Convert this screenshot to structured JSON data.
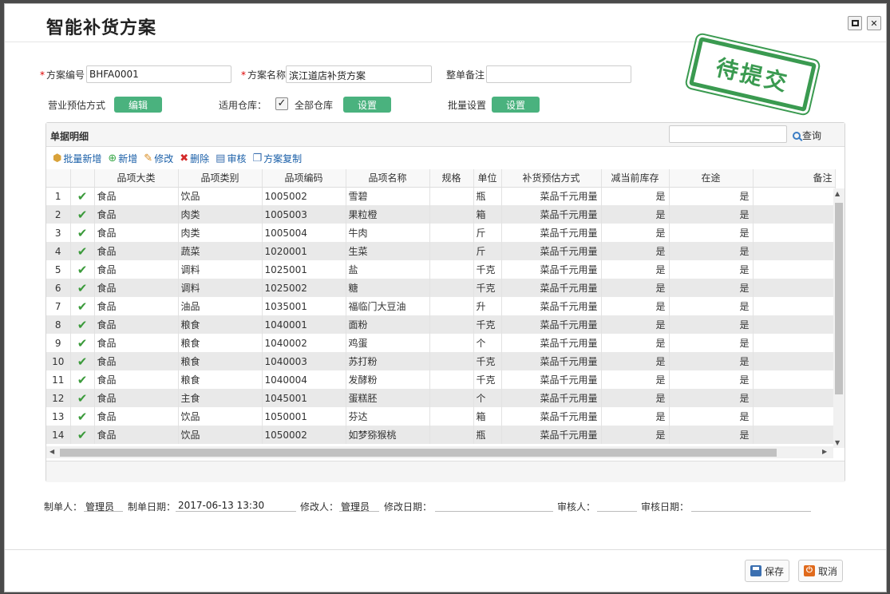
{
  "window": {
    "title": "智能补货方案",
    "stamp": "待提交"
  },
  "form": {
    "plan_no_label": "方案编号",
    "plan_no_value": "BHFA0001",
    "plan_name_label": "方案名称",
    "plan_name_value": "滨江道店补货方案",
    "remark_label": "整单备注",
    "remark_value": "",
    "forecast_label": "营业预估方式",
    "forecast_button": "编辑",
    "warehouse_label": "适用仓库：",
    "warehouse_checked": true,
    "warehouse_value": "全部仓库",
    "warehouse_button": "设置",
    "batch_label": "批量设置",
    "batch_button": "设置",
    "required_mark": "*"
  },
  "detail": {
    "title": "单据明细",
    "search_placeholder": "",
    "search_button": "查询",
    "toolbar": {
      "batch_add": "批量新增",
      "add": "新增",
      "edit": "修改",
      "delete": "删除",
      "audit": "审核",
      "copy": "方案复制"
    },
    "columns": [
      "",
      "",
      "品项大类",
      "品项类别",
      "品项编码",
      "品项名称",
      "规格",
      "单位",
      "补货预估方式",
      "减当前库存",
      "在途",
      "备注"
    ],
    "rows": [
      {
        "no": "1",
        "category": "食品",
        "type": "饮品",
        "code": "1005002",
        "name": "雪碧",
        "spec": "",
        "unit": "瓶",
        "method": "菜品千元用量",
        "reduce": "是",
        "transit": "是",
        "note": ""
      },
      {
        "no": "2",
        "category": "食品",
        "type": "肉类",
        "code": "1005003",
        "name": "果粒橙",
        "spec": "",
        "unit": "箱",
        "method": "菜品千元用量",
        "reduce": "是",
        "transit": "是",
        "note": ""
      },
      {
        "no": "3",
        "category": "食品",
        "type": "肉类",
        "code": "1005004",
        "name": "牛肉",
        "spec": "",
        "unit": "斤",
        "method": "菜品千元用量",
        "reduce": "是",
        "transit": "是",
        "note": ""
      },
      {
        "no": "4",
        "category": "食品",
        "type": "蔬菜",
        "code": "1020001",
        "name": "生菜",
        "spec": "",
        "unit": "斤",
        "method": "菜品千元用量",
        "reduce": "是",
        "transit": "是",
        "note": ""
      },
      {
        "no": "5",
        "category": "食品",
        "type": "调料",
        "code": "1025001",
        "name": "盐",
        "spec": "",
        "unit": "千克",
        "method": "菜品千元用量",
        "reduce": "是",
        "transit": "是",
        "note": ""
      },
      {
        "no": "6",
        "category": "食品",
        "type": "调料",
        "code": "1025002",
        "name": "糖",
        "spec": "",
        "unit": "千克",
        "method": "菜品千元用量",
        "reduce": "是",
        "transit": "是",
        "note": ""
      },
      {
        "no": "7",
        "category": "食品",
        "type": "油品",
        "code": "1035001",
        "name": "福临门大豆油",
        "spec": "",
        "unit": "升",
        "method": "菜品千元用量",
        "reduce": "是",
        "transit": "是",
        "note": ""
      },
      {
        "no": "8",
        "category": "食品",
        "type": "粮食",
        "code": "1040001",
        "name": "面粉",
        "spec": "",
        "unit": "千克",
        "method": "菜品千元用量",
        "reduce": "是",
        "transit": "是",
        "note": ""
      },
      {
        "no": "9",
        "category": "食品",
        "type": "粮食",
        "code": "1040002",
        "name": "鸡蛋",
        "spec": "",
        "unit": "个",
        "method": "菜品千元用量",
        "reduce": "是",
        "transit": "是",
        "note": ""
      },
      {
        "no": "10",
        "category": "食品",
        "type": "粮食",
        "code": "1040003",
        "name": "苏打粉",
        "spec": "",
        "unit": "千克",
        "method": "菜品千元用量",
        "reduce": "是",
        "transit": "是",
        "note": ""
      },
      {
        "no": "11",
        "category": "食品",
        "type": "粮食",
        "code": "1040004",
        "name": "发酵粉",
        "spec": "",
        "unit": "千克",
        "method": "菜品千元用量",
        "reduce": "是",
        "transit": "是",
        "note": ""
      },
      {
        "no": "12",
        "category": "食品",
        "type": "主食",
        "code": "1045001",
        "name": "蛋糕胚",
        "spec": "",
        "unit": "个",
        "method": "菜品千元用量",
        "reduce": "是",
        "transit": "是",
        "note": ""
      },
      {
        "no": "13",
        "category": "食品",
        "type": "饮品",
        "code": "1050001",
        "name": "芬达",
        "spec": "",
        "unit": "箱",
        "method": "菜品千元用量",
        "reduce": "是",
        "transit": "是",
        "note": ""
      },
      {
        "no": "14",
        "category": "食品",
        "type": "饮品",
        "code": "1050002",
        "name": "如梦猕猴桃",
        "spec": "",
        "unit": "瓶",
        "method": "菜品千元用量",
        "reduce": "是",
        "transit": "是",
        "note": ""
      }
    ]
  },
  "footer_info": {
    "creator_label": "制单人：",
    "creator_value": "管理员",
    "created_label": "制单日期：",
    "created_value": "2017-06-13 13:30",
    "modifier_label": "修改人：",
    "modifier_value": "管理员",
    "modified_label": "修改日期：",
    "modified_value": "",
    "auditor_label": "审核人：",
    "auditor_value": "",
    "audited_label": "审核日期：",
    "audited_value": ""
  },
  "actions": {
    "save": "保存",
    "cancel": "取消"
  },
  "colors": {
    "accent_green": "#4ab27e",
    "stamp_green": "#3a9a50",
    "link_blue": "#1a5fa8"
  }
}
